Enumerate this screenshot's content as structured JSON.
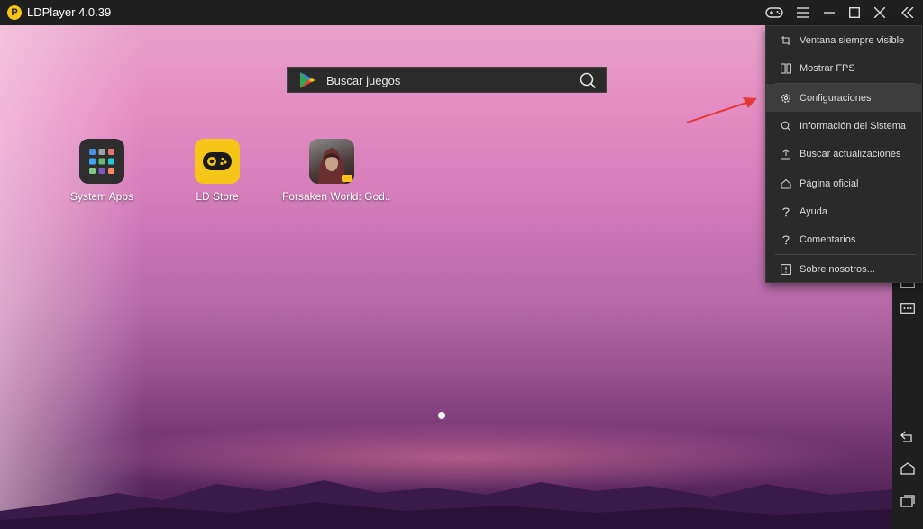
{
  "window": {
    "title": "LDPlayer 4.0.39",
    "logo_letter": "P"
  },
  "search": {
    "placeholder": "Buscar juegos"
  },
  "apps": [
    {
      "label": "System Apps",
      "icon": "grid-apps-icon"
    },
    {
      "label": "LD Store",
      "icon": "gamepad-store-icon"
    },
    {
      "label": "Forsaken World: God..",
      "icon": "game-avatar-icon"
    }
  ],
  "menu": {
    "items": [
      {
        "label": "Ventana siempre visible",
        "icon": "pin-window-icon"
      },
      {
        "label": "Mostrar FPS",
        "icon": "fps-icon"
      },
      {
        "label": "Configuraciones",
        "icon": "gear-icon",
        "active": true
      },
      {
        "label": "Información del Sistema",
        "icon": "search-icon"
      },
      {
        "label": "Buscar actualizaciones",
        "icon": "upload-icon"
      },
      {
        "label": "Página oficial",
        "icon": "home-icon"
      },
      {
        "label": "Ayuda",
        "icon": "question-icon"
      },
      {
        "label": "Comentarios",
        "icon": "question-icon"
      },
      {
        "label": "Sobre nosotros...",
        "icon": "info-icon"
      }
    ]
  },
  "colors": {
    "titlebar": "#1f1f1f",
    "menu_bg": "#2a2a2a",
    "menu_active": "#3d3d3d",
    "arrow": "#e53935",
    "ld_yellow": "#f5c518"
  }
}
